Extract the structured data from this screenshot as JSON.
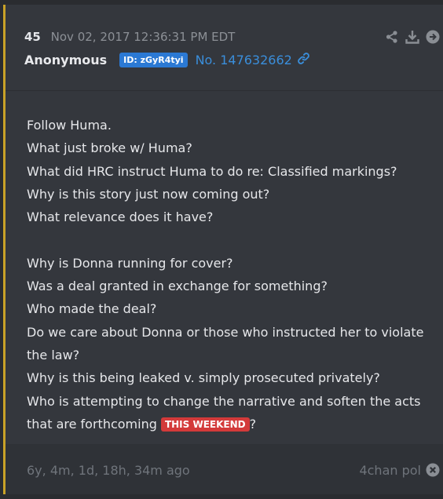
{
  "post": {
    "number": "45",
    "date": "Nov 02, 2017 12:36:31 PM EDT",
    "author": "Anonymous",
    "id_badge": "ID: zGyR4tyi",
    "post_no": "No. 147632662",
    "lines_a": [
      "Follow Huma.",
      "What just broke w/ Huma?",
      "What did HRC instruct Huma to do re: Classified markings?",
      "Why is this story just now coming out?",
      "What relevance does it have?"
    ],
    "lines_b": [
      "Why is Donna running for cover?",
      "Was a deal granted in exchange for something?",
      "Who made the deal?",
      "Do we care about Donna or those who instructed her to violate the law?",
      "Why is this being leaked v. simply prosecuted privately?"
    ],
    "last_line_text": "Who is attempting to change the narrative and soften the acts that are forthcoming ",
    "tag": "THIS WEEKEND",
    "last_line_end": "?"
  },
  "footer": {
    "time_ago": "6y, 4m, 1d, 18h, 34m ago",
    "source": "4chan pol"
  },
  "colors": {
    "accent_border": "#c9a227",
    "id_badge": "#2b79d4",
    "link": "#3a8edb",
    "tag": "#d33a3a"
  },
  "icons": [
    "share-icon",
    "download-icon",
    "arrow-right-circle-icon",
    "link-icon",
    "close-circle-icon"
  ]
}
